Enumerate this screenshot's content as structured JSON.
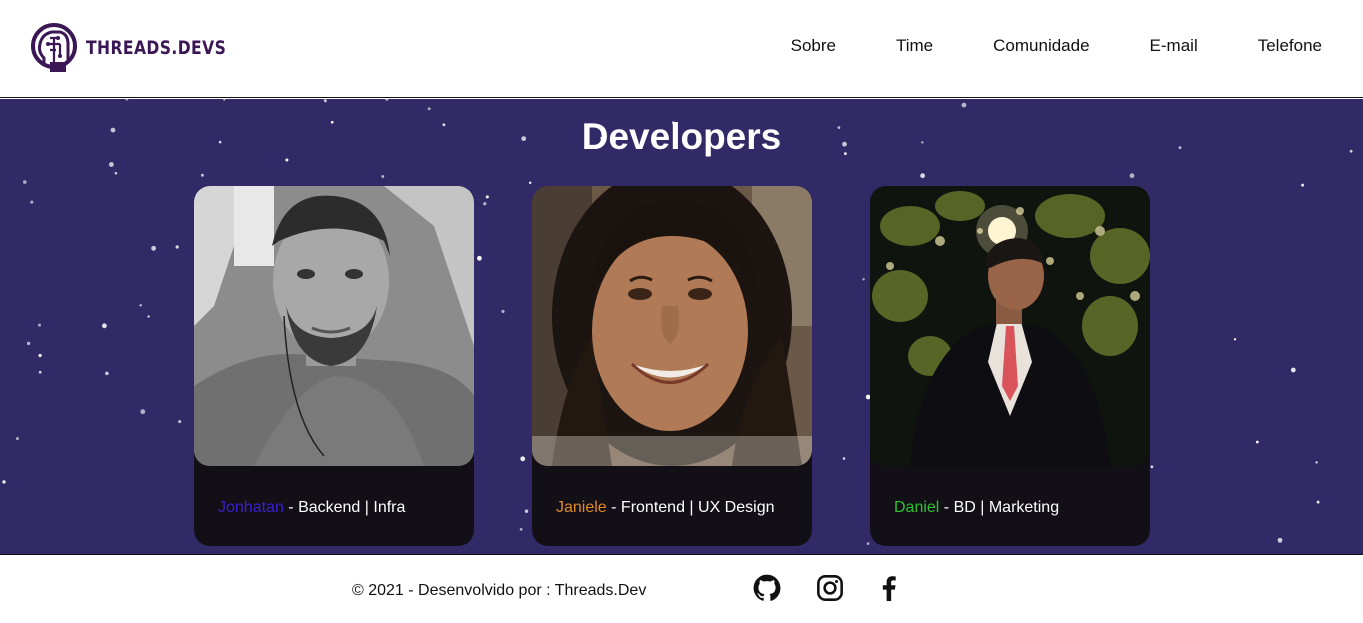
{
  "brand": {
    "name": "THREADS.DEVS",
    "logo_icon": "brain-head-icon",
    "color": "#3b1756"
  },
  "nav": [
    {
      "label": "Sobre"
    },
    {
      "label": "Time"
    },
    {
      "label": "Comunidade"
    },
    {
      "label": "E-mail"
    },
    {
      "label": "Telefone"
    }
  ],
  "main": {
    "title": "Developers",
    "background": "#322a66",
    "cards": [
      {
        "name": "Jonhatan",
        "name_color": "#3b1fd6",
        "role": " - Backend | Infra",
        "photo": "person-photo"
      },
      {
        "name": "Janiele",
        "name_color": "#e0882a",
        "role": " - Frontend | UX Design",
        "photo": "person-photo"
      },
      {
        "name": "Daniel",
        "name_color": "#2bc22b",
        "role": " - BD | Marketing",
        "photo": "person-photo"
      }
    ]
  },
  "footer": {
    "copyright": "© 2021 - Desenvolvido por : Threads.Dev",
    "social": [
      "github-icon",
      "instagram-icon",
      "facebook-icon"
    ]
  }
}
